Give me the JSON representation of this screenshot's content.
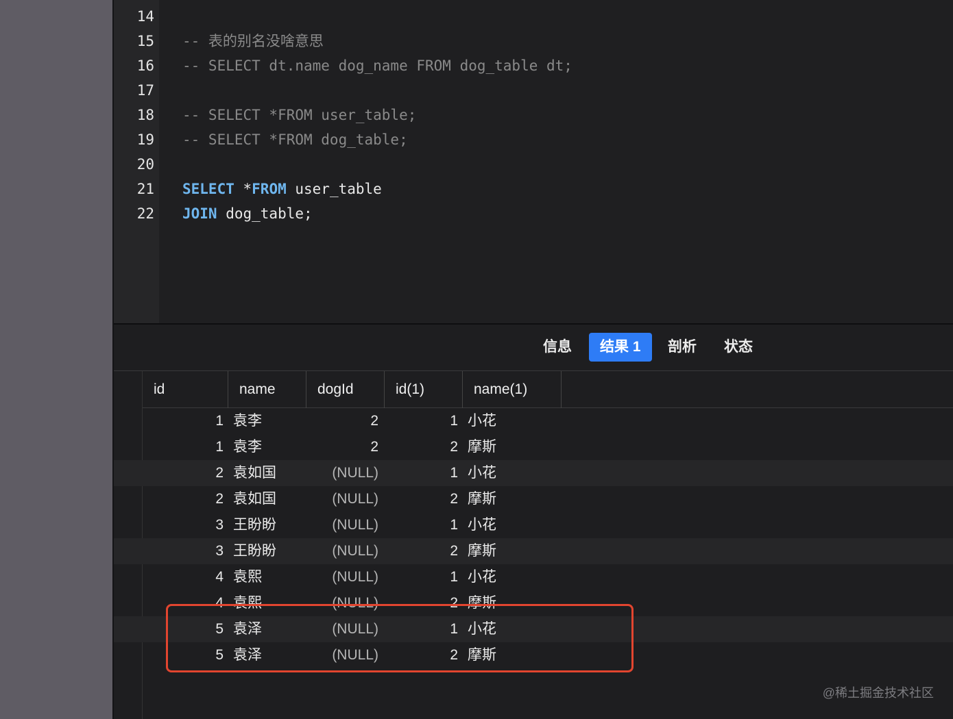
{
  "editor": {
    "lines": [
      {
        "num": "14",
        "text": "",
        "type": "blank"
      },
      {
        "num": "15",
        "text": "-- 表的别名没啥意思",
        "type": "comment"
      },
      {
        "num": "16",
        "text": "-- SELECT dt.name dog_name FROM dog_table dt;",
        "type": "comment"
      },
      {
        "num": "17",
        "text": "",
        "type": "blank"
      },
      {
        "num": "18",
        "text": "-- SELECT *FROM user_table;",
        "type": "comment"
      },
      {
        "num": "19",
        "text": "-- SELECT *FROM dog_table;",
        "type": "comment"
      },
      {
        "num": "20",
        "text": "",
        "type": "blank"
      },
      {
        "num": "21",
        "kw1": "SELECT",
        "mid": " *",
        "kw2": "FROM",
        "rest": " user_table",
        "type": "code"
      },
      {
        "num": "22",
        "kw1": "JOIN",
        "rest": " dog_table;",
        "type": "code2"
      }
    ]
  },
  "tabs": [
    {
      "label": "信息",
      "active": false
    },
    {
      "label": "结果 1",
      "active": true
    },
    {
      "label": "剖析",
      "active": false
    },
    {
      "label": "状态",
      "active": false
    }
  ],
  "table": {
    "columns": [
      "id",
      "name",
      "dogId",
      "id(1)",
      "name(1)"
    ],
    "rows": [
      [
        "1",
        "袁李",
        "2",
        "1",
        "小花"
      ],
      [
        "1",
        "袁李",
        "2",
        "2",
        "摩斯"
      ],
      [
        "2",
        "袁如国",
        "(NULL)",
        "1",
        "小花"
      ],
      [
        "2",
        "袁如国",
        "(NULL)",
        "2",
        "摩斯"
      ],
      [
        "3",
        "王盼盼",
        "(NULL)",
        "1",
        "小花"
      ],
      [
        "3",
        "王盼盼",
        "(NULL)",
        "2",
        "摩斯"
      ],
      [
        "4",
        "袁熙",
        "(NULL)",
        "1",
        "小花"
      ],
      [
        "4",
        "袁熙",
        "(NULL)",
        "2",
        "摩斯"
      ],
      [
        "5",
        "袁泽",
        "(NULL)",
        "1",
        "小花"
      ],
      [
        "5",
        "袁泽",
        "(NULL)",
        "2",
        "摩斯"
      ]
    ]
  },
  "watermark": "@稀土掘金技术社区",
  "colors": {
    "accent": "#2e7cf6",
    "highlight": "#e2452f",
    "keyword": "#6fb6ee"
  }
}
